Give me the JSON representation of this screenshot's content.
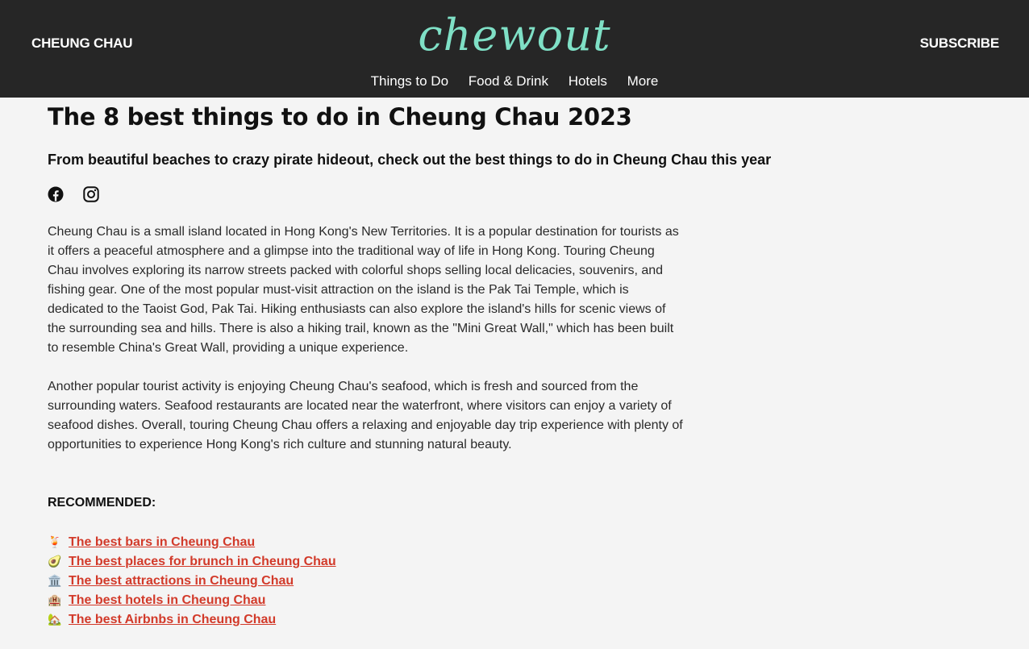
{
  "header": {
    "site_name": "CHEUNG CHAU",
    "logo_text": "chewout",
    "subscribe_label": "SUBSCRIBE",
    "nav": [
      "Things to Do",
      "Food & Drink",
      "Hotels",
      "More"
    ]
  },
  "article": {
    "title": "The 8 best things to do in Cheung Chau 2023",
    "subtitle": "From beautiful beaches to crazy pirate hideout, check out the best things to do in Cheung Chau this year",
    "share_icons": [
      "facebook-icon",
      "instagram-icon"
    ],
    "paragraphs": [
      "Cheung Chau is a small island located in Hong Kong's New Territories. It is a popular destination for tourists as it offers a peaceful atmosphere and a glimpse into the traditional way of life in Hong Kong. Touring Cheung Chau involves exploring its narrow streets packed with colorful shops selling local delicacies, souvenirs, and fishing gear. One of the most popular must-visit attraction on the island is the Pak Tai Temple, which is dedicated to the Taoist God, Pak Tai. Hiking enthusiasts can also explore the island's hills for scenic views of the surrounding sea and hills. There is also a hiking trail, known as the \"Mini Great Wall,\" which has been built to resemble China's Great Wall, providing a unique experience.",
      "Another popular tourist activity is enjoying Cheung Chau's seafood, which is fresh and sourced from the surrounding waters. Seafood restaurants are located near the waterfront, where visitors can enjoy a variety of seafood dishes. Overall, touring Cheung Chau offers a relaxing and enjoyable day trip experience with plenty of opportunities to experience Hong Kong's rich culture and stunning natural beauty."
    ],
    "recommended_label": "RECOMMENDED:",
    "recommended": [
      {
        "emoji": "🍹",
        "text": "The best bars in Cheung Chau"
      },
      {
        "emoji": "🥑",
        "text": "The best places for brunch in Cheung Chau"
      },
      {
        "emoji": "🏛️",
        "text": "The best attractions in Cheung Chau"
      },
      {
        "emoji": "🏨",
        "text": "The best hotels in Cheung Chau"
      },
      {
        "emoji": "🏡",
        "text": "The best Airbnbs in Cheung Chau"
      }
    ]
  },
  "colors": {
    "header_bg": "#262626",
    "logo": "#7fe0c6",
    "link": "#d23a2a",
    "page_bg": "#f4f4f4"
  }
}
